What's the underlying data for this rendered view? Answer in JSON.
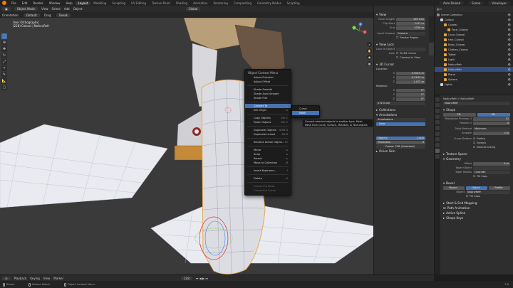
{
  "topbar": {
    "menus": [
      "File",
      "Edit",
      "Render",
      "Window",
      "Help"
    ],
    "workspaces": [
      "Layout",
      "Modeling",
      "Sculpting",
      "UV Editing",
      "Texture Paint",
      "Shading",
      "Animation",
      "Rendering",
      "Compositing",
      "Geometry Nodes",
      "Scripting"
    ],
    "active_workspace": "Layout",
    "scene_label": "Scene",
    "view_layer_label": "ViewLayer",
    "auto_reload": "Auto Reload"
  },
  "viewport_header": {
    "mode": "Object Mode",
    "menus": [
      "View",
      "Select",
      "Add",
      "Object"
    ],
    "orientation": "Global",
    "transform_row": [
      "Orientation:",
      "Default",
      "Drag:",
      "Tweak"
    ]
  },
  "viewport": {
    "view_name": "User Orthographic",
    "collection_line": "(228) Colossi | NoAnvRefr",
    "gizmo_axes": [
      "X",
      "Y",
      "Z"
    ]
  },
  "context_menu": {
    "title": "Object Context Menu",
    "items": [
      {
        "label": "Adjust Primsion",
        "shortcut": "",
        "state": "normal"
      },
      {
        "label": "Adjust Offset",
        "shortcut": "",
        "state": "normal"
      },
      {
        "sep": true
      },
      {
        "label": "Shade Smooth",
        "shortcut": "",
        "state": "normal"
      },
      {
        "label": "Shade Auto Smooth",
        "shortcut": "",
        "state": "normal"
      },
      {
        "label": "Shade Flat",
        "shortcut": "",
        "state": "normal"
      },
      {
        "sep": true
      },
      {
        "label": "Convert To",
        "shortcut": "▸",
        "state": "hl"
      },
      {
        "label": "Set Origin",
        "shortcut": "▸",
        "state": "normal"
      },
      {
        "sep": true
      },
      {
        "label": "Copy Objects",
        "shortcut": "Ctrl C",
        "state": "normal"
      },
      {
        "label": "Paste Objects",
        "shortcut": "Ctrl V",
        "state": "normal"
      },
      {
        "sep": true
      },
      {
        "label": "Duplicate Objects",
        "shortcut": "Shift D",
        "state": "normal"
      },
      {
        "label": "Duplicate Linked",
        "shortcut": "Alt D",
        "state": "normal"
      },
      {
        "sep": true
      },
      {
        "label": "Rename Active Object...",
        "shortcut": "F2",
        "state": "normal"
      },
      {
        "sep": true
      },
      {
        "label": "Mirror",
        "shortcut": "▸",
        "state": "normal"
      },
      {
        "label": "Snap",
        "shortcut": "▸",
        "state": "normal"
      },
      {
        "label": "Parent",
        "shortcut": "▸",
        "state": "normal"
      },
      {
        "label": "Move to Collection",
        "shortcut": "M",
        "state": "normal"
      },
      {
        "sep": true
      },
      {
        "label": "Insert Keyframe...",
        "shortcut": "I",
        "state": "normal"
      },
      {
        "sep": true
      },
      {
        "label": "Delete",
        "shortcut": "X",
        "state": "normal"
      },
      {
        "sep": true
      },
      {
        "label": "Convert to Mesh",
        "shortcut": "",
        "state": "dim"
      },
      {
        "label": "Convert to Curve",
        "shortcut": "",
        "state": "dim"
      }
    ]
  },
  "submenu": {
    "items": [
      {
        "label": "Curve",
        "state": "normal"
      },
      {
        "label": "Mesh",
        "state": "hl"
      }
    ]
  },
  "tooltip": {
    "line1": "Convert selected objects to another type.  Mesh",
    "line2": "Mesh from Curve, Surface, Metaball, or Text objects"
  },
  "sidebar_n": {
    "tabs": [
      "Item",
      "Tool",
      "View"
    ],
    "view_panel": {
      "title": "View",
      "rows": [
        {
          "label": "Focal Length",
          "value": "120 mm"
        },
        {
          "label": "Clip Start",
          "value": "0.01 m"
        },
        {
          "label": "End",
          "value": "1000 m"
        }
      ],
      "local_camera": "Local Camera",
      "camera_field": "Camera",
      "render_region": "Render Region"
    },
    "view_lock": {
      "title": "View Lock",
      "lock_object": "Lock to Object",
      "lock_label": "Lock",
      "to_3d_cursor": "To 3D Cursor",
      "camera_to_view": "Camera to View"
    },
    "cursor_panel": {
      "title": "3D Cursor",
      "location": "Location:",
      "rows": [
        {
          "label": "X",
          "value": "0.0015 m"
        },
        {
          "label": "Y",
          "value": "-0.5145 m"
        },
        {
          "label": "Z",
          "value": "1.472 m"
        }
      ],
      "rotation": "Rotation:",
      "rot_rows": [
        {
          "label": "X",
          "value": "0°"
        },
        {
          "label": "Y",
          "value": "0°"
        },
        {
          "label": "Z",
          "value": "0°"
        }
      ],
      "mode": "XYZ Euler"
    },
    "collections": "Collections",
    "annotations": {
      "title": "Annotations",
      "layer": "Annotations",
      "note": "Note",
      "opacity_label": "Opacity",
      "opacity": "1.000",
      "thickness_label": "Thickness",
      "thickness": "3",
      "frame": "Frame: 228 (Unlocked)"
    },
    "onion_skin": "Onion Skin"
  },
  "outliner": {
    "title": "Scene Collection",
    "rows": [
      {
        "label": "Scene Collection",
        "indent": 0,
        "color": "#8a8a8a",
        "sel": false
      },
      {
        "label": "Colossi",
        "indent": 1,
        "color": "#cfcfcf",
        "sel": false
      },
      {
        "label": "Colossi",
        "indent": 2,
        "color": "#e8a33d",
        "sel": false
      },
      {
        "label": "Face_Colossi",
        "indent": 3,
        "color": "#e8a33d",
        "sel": false
      },
      {
        "label": "Coco_Colossi",
        "indent": 2,
        "color": "#e8a33d",
        "sel": false
      },
      {
        "label": "Hair_Colossi",
        "indent": 2,
        "color": "#e8a33d",
        "sel": false
      },
      {
        "label": "Body_Colossi",
        "indent": 2,
        "color": "#e8a33d",
        "sel": false
      },
      {
        "label": "Clothes_Colossi",
        "indent": 2,
        "color": "#e8a33d",
        "sel": false
      },
      {
        "label": "Tablet",
        "indent": 2,
        "color": "#e8a33d",
        "sel": false
      },
      {
        "label": "Light",
        "indent": 2,
        "color": "#e8a33d",
        "sel": false
      },
      {
        "label": "NoAnvRefr",
        "indent": 2,
        "color": "#e8a33d",
        "sel": false
      },
      {
        "label": "NoAnvRefr",
        "indent": 2,
        "color": "#e8a33d",
        "sel": true
      },
      {
        "label": "Plane",
        "indent": 2,
        "color": "#e8a33d",
        "sel": false
      },
      {
        "label": "Sphere",
        "indent": 2,
        "color": "#e8a33d",
        "sel": false
      },
      {
        "label": "Lights",
        "indent": 1,
        "color": "#cfcfcf",
        "sel": false
      }
    ]
  },
  "properties": {
    "breadcrumb": "NoAnvRefr  >  NoAnvRefr",
    "name_field": "NoAnvRefr",
    "shape": {
      "title": "Shape",
      "tabs": [
        "2D",
        "3D"
      ],
      "rows": [
        {
          "label": "Resolution Preview U",
          "value": "12"
        },
        {
          "label": "Render U",
          "value": "0"
        }
      ],
      "twist_method_label": "Twist Method",
      "twist_method": "Minimum",
      "smooth_label": "Smooth",
      "smooth": "0.0",
      "curve_deform": "Curve Deform",
      "radius": "Radius",
      "stretch": "Stretch",
      "bounds_clamp": "Bounds Clamp"
    },
    "texture_space": "Texture Space",
    "geometry": {
      "title": "Geometry",
      "offset_label": "Offset",
      "offset": "0 m",
      "taper_object": "Taper Object",
      "taper_radius": "Taper Radius",
      "taper_radius_val": "Override",
      "fill_caps": "Fill Caps"
    },
    "bevel": {
      "title": "Bevel",
      "tabs": [
        "Round",
        "Object",
        "Profile"
      ],
      "active_tab": "Object",
      "object_label": "Object",
      "object_value": "NoAnvRefr",
      "fill_caps": "Fill Caps"
    },
    "path_animation": "Start & End Mapping",
    "path_anim2": "Path Animation",
    "active_spline": "Active Spline",
    "shape_keys": "Shape Keys"
  },
  "timeline": {
    "items": [
      "Playback",
      "Keying",
      "View",
      "Marker"
    ],
    "frame": "228"
  },
  "statusbar": {
    "items": [
      "Select",
      "Extend Select",
      "Object Context Menu"
    ],
    "version": "3.6"
  },
  "colors": {
    "accent": "#4772b3",
    "brand": "#e87d0d"
  }
}
